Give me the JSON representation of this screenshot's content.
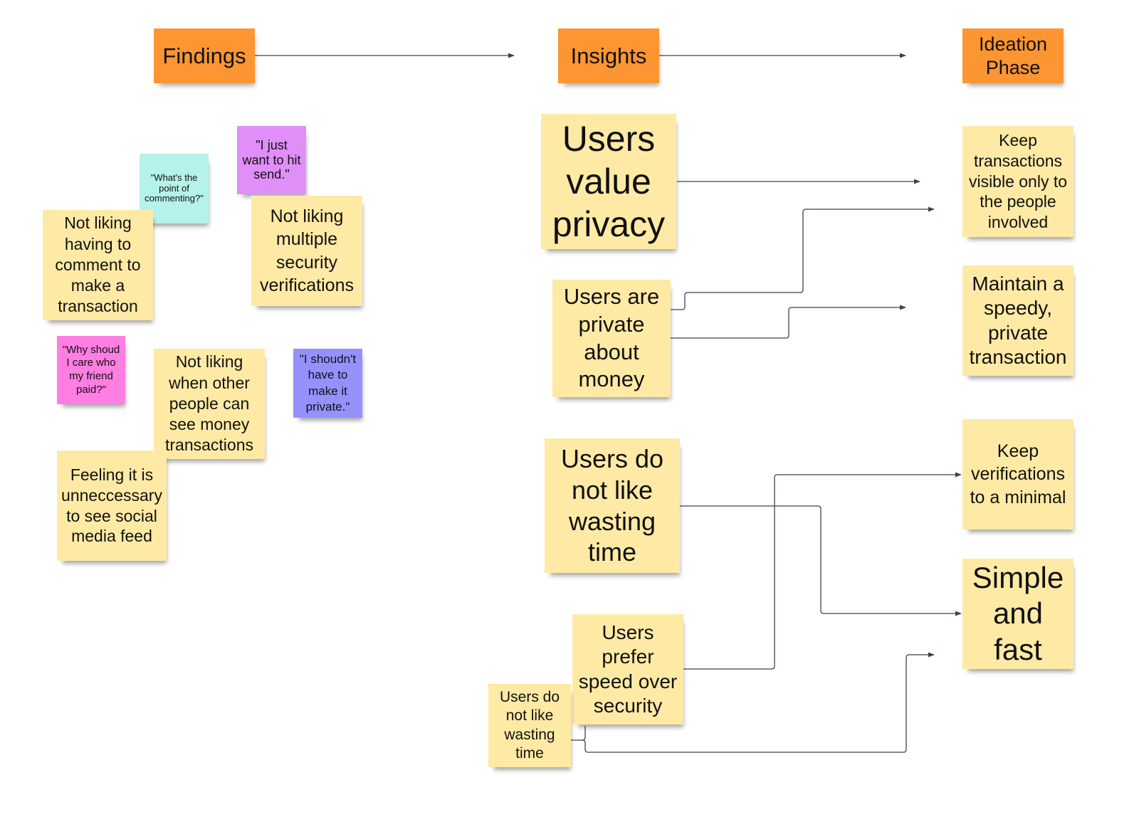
{
  "colors": {
    "header": "#fc9532",
    "sticky_yellow": "#ffeaa5",
    "sticky_teal": "#b4f2ea",
    "sticky_purple": "#e08ef8",
    "sticky_pink": "#ff7ee1",
    "sticky_blue": "#9491fd",
    "connector": "#3d4250"
  },
  "headers": {
    "findings": "Findings",
    "insights": "Insights",
    "ideation": "Ideation Phase"
  },
  "findings": {
    "quote_commenting": "\"What's the point of commenting?\"",
    "quote_hit_send": "\"I just want to hit send.\"",
    "comment_to_transact": "Not liking having to comment to make a transaction",
    "multiple_verifications": "Not liking multiple security verifications",
    "quote_friend_paid": "\"Why shoud I care who my friend paid?\"",
    "others_see_transactions": "Not liking when other people can see money transactions",
    "quote_make_private": "\"I shoudn't have to make it private.\"",
    "social_feed": "Feeling it is unneccessary to see social media feed"
  },
  "insights": {
    "value_privacy": "Users value privacy",
    "private_money": "Users are private about money",
    "wasting_time_large": "Users do not like wasting time",
    "speed_over_security": "Users prefer speed over security",
    "wasting_time_small": "Users do not like wasting time"
  },
  "ideation": {
    "visible_involved": "Keep transactions visible only to the people involved",
    "speedy_private": "Maintain a speedy, private transaction",
    "minimal_verifications": "Keep verifications to a minimal",
    "simple_fast": "Simple and fast"
  },
  "connections": [
    {
      "from": "headers.findings",
      "to": "headers.insights"
    },
    {
      "from": "headers.insights",
      "to": "headers.ideation"
    },
    {
      "from": "insights.value_privacy",
      "to": "ideation.visible_involved"
    },
    {
      "from": "insights.private_money",
      "to": "ideation.visible_involved"
    },
    {
      "from": "insights.private_money",
      "to": "ideation.speedy_private"
    },
    {
      "from": "insights.wasting_time_large",
      "to": "ideation.simple_fast"
    },
    {
      "from": "insights.speed_over_security",
      "to": "ideation.minimal_verifications"
    },
    {
      "from": "insights.wasting_time_small",
      "to": "ideation.simple_fast"
    }
  ]
}
